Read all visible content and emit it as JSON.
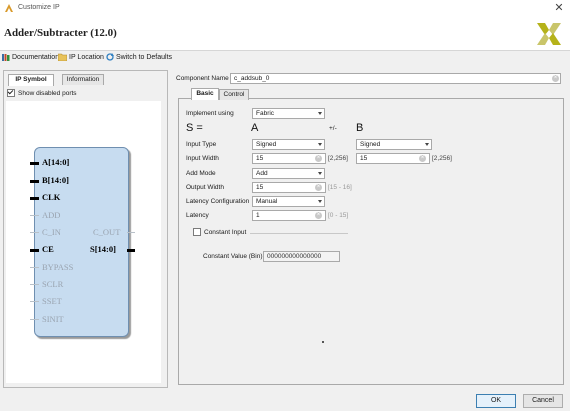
{
  "window": {
    "title": "Customize IP",
    "close_glyph": "✕"
  },
  "heading": "Adder/Subtracter (12.0)",
  "toolbar": {
    "documentation": "Documentation",
    "ip_location": "IP Location",
    "switch_defaults": "Switch to Defaults"
  },
  "left_tabs": [
    "IP Symbol",
    "Information"
  ],
  "show_disabled_ports": "Show disabled ports",
  "ports_left": [
    {
      "name": "A[14:0]",
      "enabled": true
    },
    {
      "name": "B[14:0]",
      "enabled": true
    },
    {
      "name": "CLK",
      "enabled": true
    },
    {
      "name": "ADD",
      "enabled": false
    },
    {
      "name": "C_IN",
      "enabled": false
    },
    {
      "name": "CE",
      "enabled": true
    },
    {
      "name": "BYPASS",
      "enabled": false
    },
    {
      "name": "SCLR",
      "enabled": false
    },
    {
      "name": "SSET",
      "enabled": false
    },
    {
      "name": "SINIT",
      "enabled": false
    }
  ],
  "ports_right": [
    {
      "name": "C_OUT",
      "enabled": false
    },
    {
      "name": "S[14:0]",
      "enabled": true
    }
  ],
  "component": {
    "label": "Component Name",
    "value": "c_addsub_0"
  },
  "right_tabs": [
    "Basic",
    "Control"
  ],
  "form": {
    "implement_label": "Implement using",
    "implement_value": "Fabric",
    "s_eq": "S =",
    "a_head": "A",
    "op_head": "+/-",
    "b_head": "B",
    "input_type_label": "Input Type",
    "a_type": "Signed",
    "b_type": "Signed",
    "input_width_label": "Input Width",
    "a_width": "15",
    "a_range": "[2,256]",
    "b_width": "15",
    "b_range": "[2,256]",
    "add_mode_label": "Add Mode",
    "add_mode_value": "Add",
    "output_width_label": "Output Width",
    "output_width": "15",
    "output_range": "[15 - 16]",
    "latency_config_label": "Latency Configuration",
    "latency_config_value": "Manual",
    "latency_label": "Latency",
    "latency_value": "1",
    "latency_range": "[0 - 15]",
    "constant_input_label": "Constant Input",
    "constant_value_label": "Constant Value (Bin)",
    "constant_value": "000000000000000"
  },
  "buttons": {
    "ok": "OK",
    "cancel": "Cancel"
  },
  "colors": {
    "block_fill": "#c7dcf0",
    "accent": "#3c7fb1",
    "logo": "#b5b21a"
  }
}
